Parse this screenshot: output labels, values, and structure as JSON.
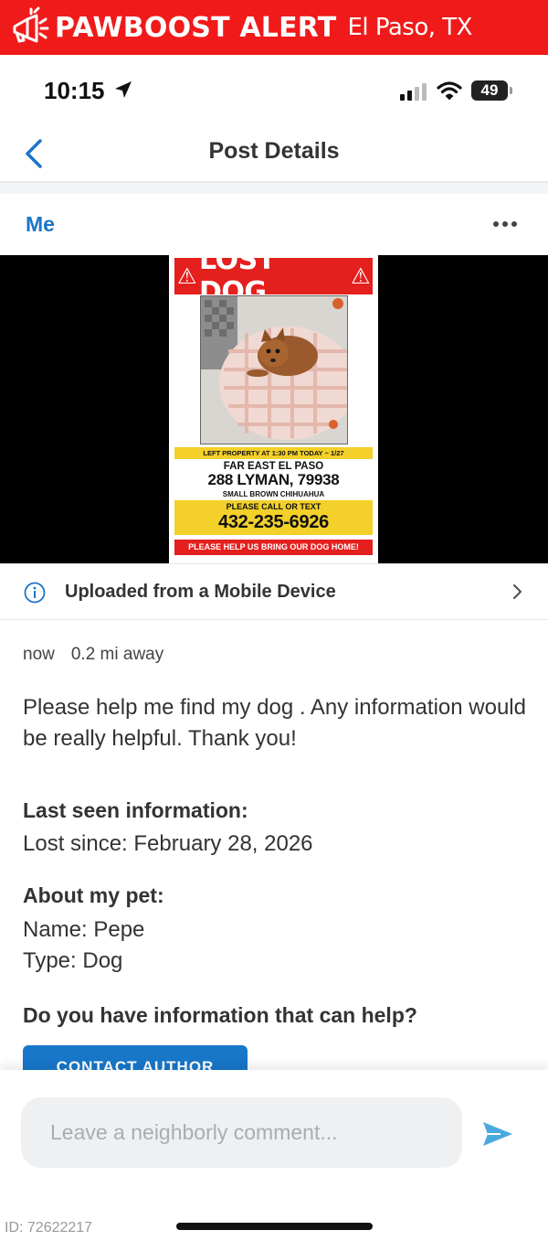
{
  "banner": {
    "brand": "PAWBOOST ALERT",
    "city": "El Paso, TX",
    "icon": "megaphone-icon",
    "color": "#f01a1a"
  },
  "status_bar": {
    "time": "10:15",
    "battery": "49"
  },
  "nav": {
    "title": "Post Details"
  },
  "post": {
    "author": "Me",
    "flyer": {
      "headline": "LOST DOG",
      "left_property": "LEFT PROPERTY AT 1:30 PM TODAY ~ 1/27",
      "area": "FAR EAST EL PASO",
      "address": "288 LYMAN, 79938",
      "breed": "SMALL BROWN CHIHUAHUA",
      "call_prompt": "PLEASE CALL OR TEXT",
      "phone": "432-235-6926",
      "plea": "PLEASE HELP US BRING OUR DOG HOME!"
    },
    "upload_source": "Uploaded from a Mobile Device",
    "posted": "now",
    "distance": "0.2 mi away",
    "description": "Please help me find my dog . Any information would be really helpful. Thank you!",
    "last_seen": {
      "heading": "Last seen information:",
      "lost_since": "Lost since: February 28, 2026"
    },
    "about": {
      "heading": "About my pet:",
      "name": "Name: Pepe",
      "type": "Type: Dog"
    },
    "help": {
      "heading": "Do you have information that can help?",
      "button": "CONTACT AUTHOR"
    }
  },
  "comment": {
    "placeholder": "Leave a neighborly comment..."
  },
  "footer": {
    "id": "ID: 72622217"
  },
  "colors": {
    "accent": "#1b75c7",
    "button": "#1877c9",
    "send": "#4aa8e0"
  }
}
